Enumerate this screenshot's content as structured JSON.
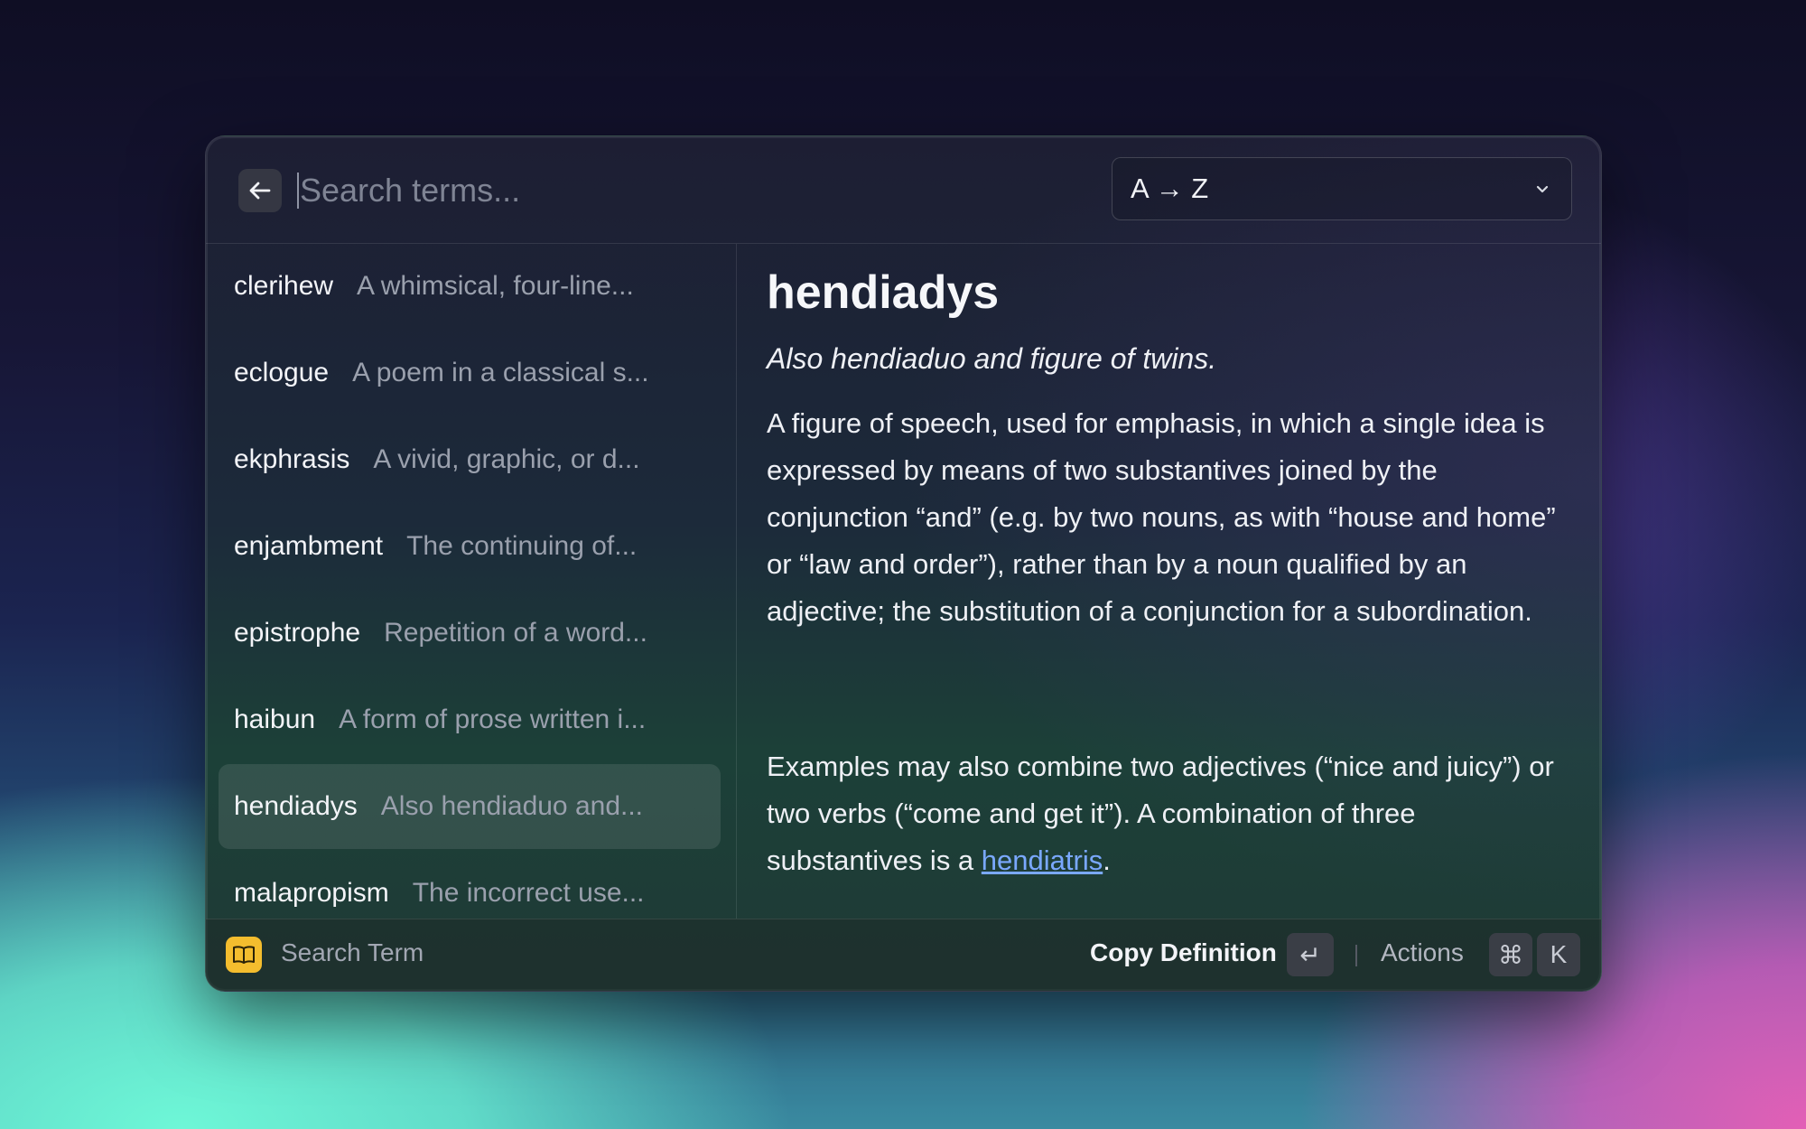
{
  "search": {
    "placeholder": "Search terms..."
  },
  "sort": {
    "selected": "A → Z"
  },
  "list": [
    {
      "term": "clerihew",
      "excerpt": "A whimsical, four-line..."
    },
    {
      "term": "eclogue",
      "excerpt": "A poem in a classical s..."
    },
    {
      "term": "ekphrasis",
      "excerpt": "A vivid, graphic, or d..."
    },
    {
      "term": "enjambment",
      "excerpt": "The continuing of..."
    },
    {
      "term": "epistrophe",
      "excerpt": "Repetition of a word..."
    },
    {
      "term": "haibun",
      "excerpt": "A form of prose written i..."
    },
    {
      "term": "hendiadys",
      "excerpt": "Also hendiaduo and...",
      "selected": true
    },
    {
      "term": "malapropism",
      "excerpt": "The incorrect use..."
    }
  ],
  "detail": {
    "title": "hendiadys",
    "aka": "Also hendiaduo and figure of twins.",
    "paragraph1": "A figure of speech, used for emphasis, in which a single idea is expressed by means of two substantives joined by the conjunction “and” (e.g. by two nouns, as with “house and home” or “law and order”), rather than by a noun qualified by an adjective; the substitution of a conjunction for a subordination.",
    "paragraph2_before": "Examples may also combine two adjectives (“nice and juicy”) or two verbs (“come and get it”). A combination of three substantives is a ",
    "paragraph2_link": "hendiatris",
    "paragraph2_after": "."
  },
  "footer": {
    "title": "Search Term",
    "primary_action": "Copy Definition",
    "primary_key": "↵",
    "actions_label": "Actions",
    "actions_keys": [
      "⌘",
      "K"
    ]
  },
  "colors": {
    "accent_link": "#7aa8ff",
    "app_icon": "#f4bd2e"
  }
}
